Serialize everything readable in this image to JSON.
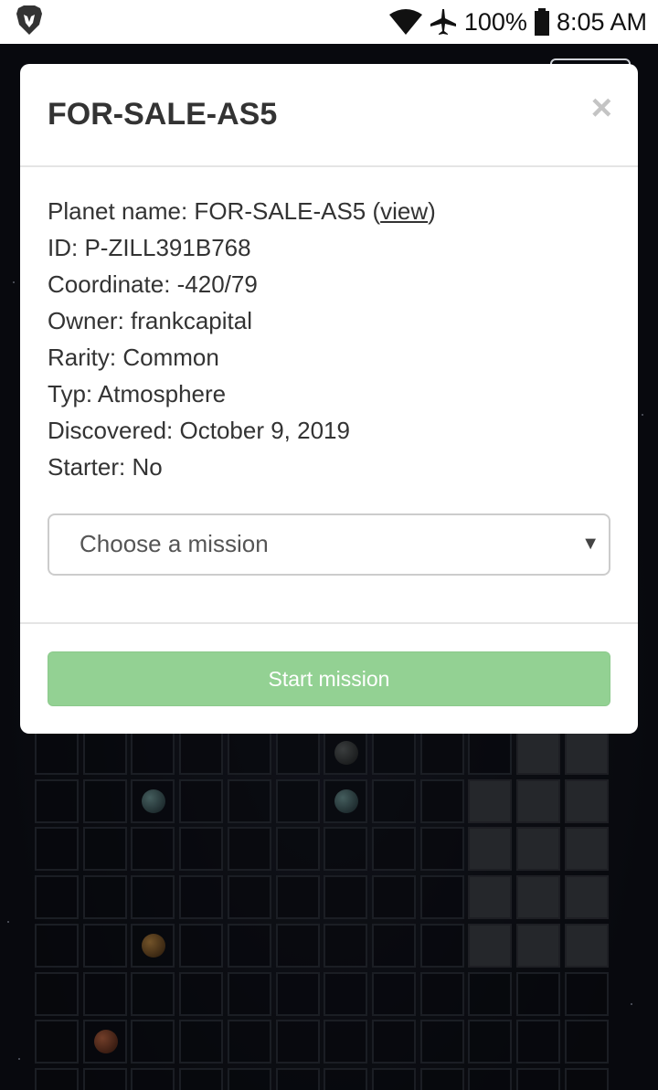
{
  "status_bar": {
    "battery": "100%",
    "time": "8:05 AM",
    "icons": [
      "brave-lion-icon",
      "wifi-icon",
      "airplane-icon",
      "battery-icon"
    ]
  },
  "modal": {
    "title": "FOR-SALE-AS5",
    "close_label": "×",
    "planet_name_label": "Planet name: FOR-SALE-AS5 (",
    "planet_name_link": "view",
    "planet_name_suffix": ")",
    "id": "ID: P-ZILL391B768",
    "coordinate": "Coordinate: -420/79",
    "owner": "Owner: frankcapital",
    "rarity": "Rarity: Common",
    "type": "Typ: Atmosphere",
    "discovered": "Discovered: October 9, 2019",
    "starter": "Starter: No",
    "mission_select": {
      "selected": "Choose a mission",
      "arrow": "▼"
    },
    "start_button": "Start mission"
  },
  "colors": {
    "start_button_bg": "#93d193",
    "background": "#0d0f16",
    "owned_cell": "#3a3c42"
  }
}
